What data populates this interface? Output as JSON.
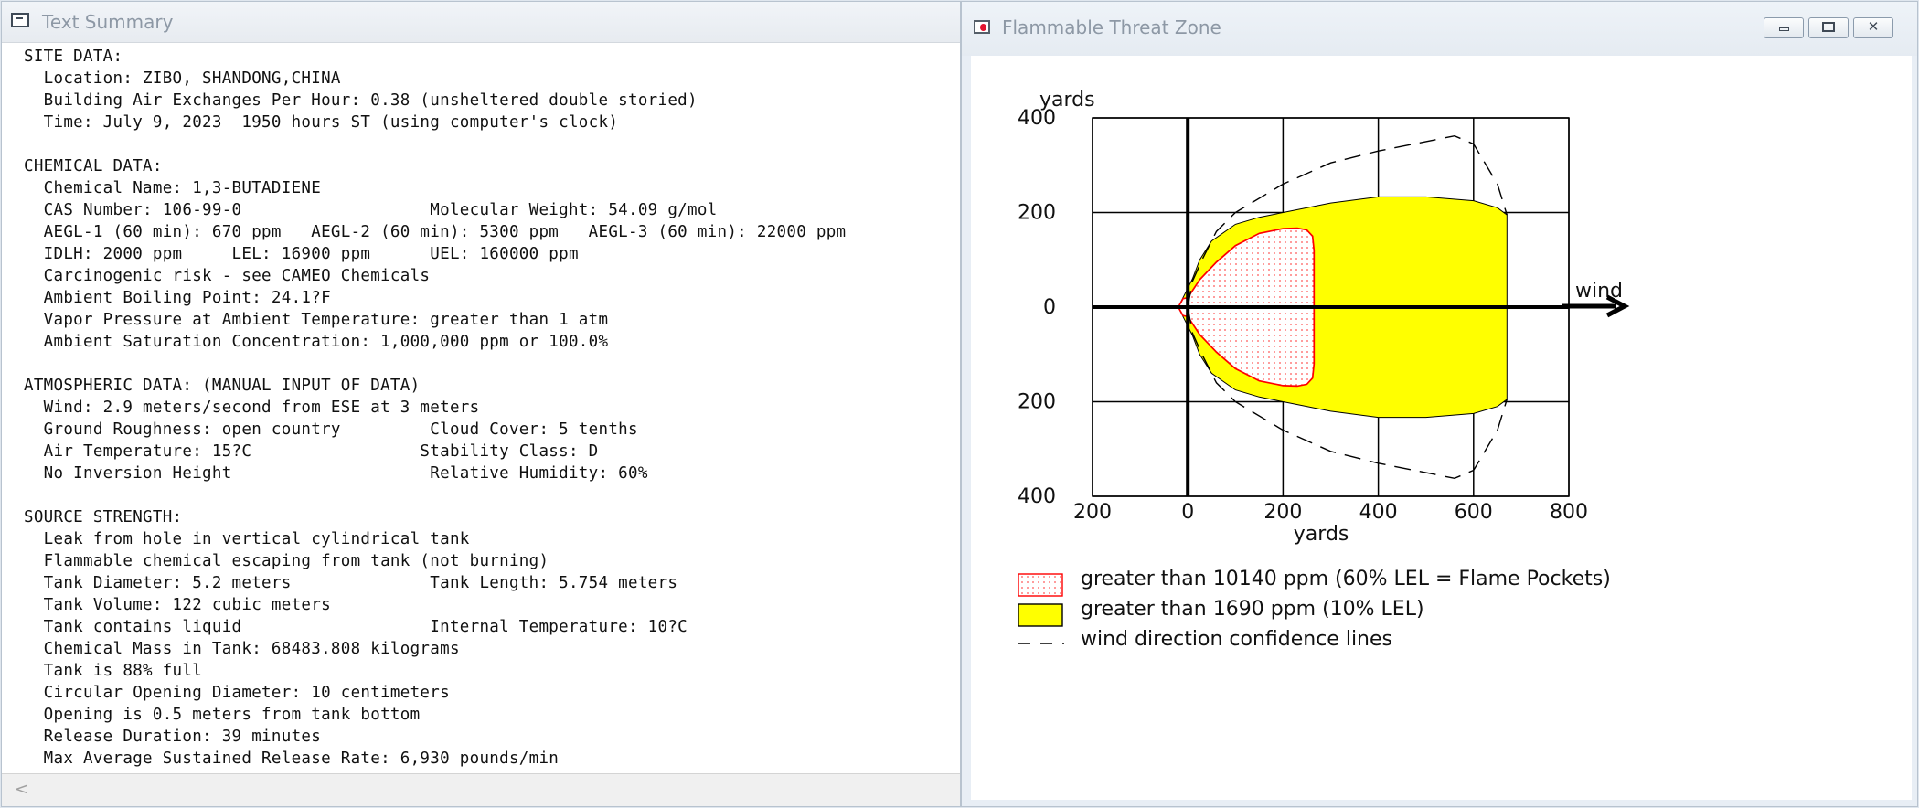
{
  "summary_window": {
    "title": "Text Summary",
    "scroll_left_glyph": "<",
    "text": "SITE DATA:\n  Location: ZIBO, SHANDONG,CHINA\n  Building Air Exchanges Per Hour: 0.38 (unsheltered double storied)\n  Time: July 9, 2023  1950 hours ST (using computer's clock)\n\nCHEMICAL DATA:\n  Chemical Name: 1,3-BUTADIENE\n  CAS Number: 106-99-0                   Molecular Weight: 54.09 g/mol\n  AEGL-1 (60 min): 670 ppm   AEGL-2 (60 min): 5300 ppm   AEGL-3 (60 min): 22000 ppm\n  IDLH: 2000 ppm     LEL: 16900 ppm      UEL: 160000 ppm\n  Carcinogenic risk - see CAMEO Chemicals\n  Ambient Boiling Point: 24.1?F\n  Vapor Pressure at Ambient Temperature: greater than 1 atm\n  Ambient Saturation Concentration: 1,000,000 ppm or 100.0%\n\nATMOSPHERIC DATA: (MANUAL INPUT OF DATA)\n  Wind: 2.9 meters/second from ESE at 3 meters\n  Ground Roughness: open country         Cloud Cover: 5 tenths\n  Air Temperature: 15?C                 Stability Class: D\n  No Inversion Height                    Relative Humidity: 60%\n\nSOURCE STRENGTH:\n  Leak from hole in vertical cylindrical tank\n  Flammable chemical escaping from tank (not burning)\n  Tank Diameter: 5.2 meters              Tank Length: 5.754 meters\n  Tank Volume: 122 cubic meters\n  Tank contains liquid                   Internal Temperature: 10?C\n  Chemical Mass in Tank: 68483.808 kilograms\n  Tank is 88% full\n  Circular Opening Diameter: 10 centimeters\n  Opening is 0.5 meters from tank bottom\n  Release Duration: 39 minutes\n  Max Average Sustained Release Rate: 6,930 pounds/min"
  },
  "threat_window": {
    "title": "Flammable Threat Zone",
    "controls": {
      "minimize_icon": "minimize-icon",
      "maximize_icon": "maximize-icon",
      "close_icon": "close-icon",
      "close_glyph": "✕"
    },
    "colors": {
      "flame_pocket_stroke": "#ff0000",
      "flame_pocket_dot": "#ff4b4b",
      "lel_fill": "#ffff00",
      "axis": "#000000"
    }
  },
  "chart_data": {
    "type": "area",
    "y_unit_label": "yards",
    "xlabel": "yards",
    "xlim": [
      -200,
      800
    ],
    "ylim": [
      -400,
      400
    ],
    "x_ticks": [
      200,
      0,
      200,
      400,
      600,
      800
    ],
    "y_ticks": [
      400,
      200,
      0,
      200,
      400
    ],
    "grid": true,
    "wind_label": "wind",
    "wind_direction": "east",
    "legend": [
      {
        "label": "greater than 10140 ppm (60% LEL = Flame Pockets)",
        "style": "red dotted zone"
      },
      {
        "label": "greater than 1690 ppm (10% LEL)",
        "style": "yellow zone"
      },
      {
        "label": "wind direction confidence lines",
        "style": "dashed line"
      }
    ],
    "series": [
      {
        "name": "greater than 1690 ppm (10% LEL)",
        "x": [
          -20,
          0,
          10,
          25,
          50,
          100,
          150,
          200,
          300,
          400,
          500,
          600,
          650,
          670
        ],
        "y": [
          0,
          40,
          60,
          100,
          140,
          175,
          190,
          200,
          220,
          233,
          233,
          225,
          210,
          195
        ]
      },
      {
        "name": "greater than 10140 ppm (60% LEL = Flame Pockets)",
        "x": [
          -20,
          -10,
          0,
          25,
          60,
          100,
          150,
          200,
          230,
          250,
          262,
          265
        ],
        "y": [
          0,
          18,
          20,
          58,
          95,
          130,
          156,
          166,
          167,
          163,
          150,
          120
        ]
      },
      {
        "name": "wind direction confidence lines",
        "x": [
          0,
          10,
          30,
          60,
          100,
          200,
          300,
          400,
          500,
          560,
          600,
          650,
          670
        ],
        "y": [
          0,
          55,
          100,
          160,
          200,
          260,
          305,
          330,
          350,
          362,
          345,
          260,
          195
        ]
      }
    ]
  }
}
